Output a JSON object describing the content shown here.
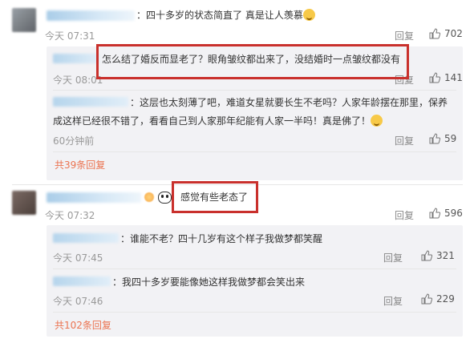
{
  "comments": [
    {
      "text": "：四十多岁的状态简直了 真是让人羡慕",
      "time": "今天 07:31",
      "reply_label": "回复",
      "likes": "702",
      "replies": [
        {
          "text": "怎么结了婚反而显老了？眼角皱纹都出来了，没结婚时一点皱纹都没有",
          "time": "今天 08:01",
          "reply_label": "回复",
          "likes": "141"
        },
        {
          "text_line1": "：这层也太刻薄了吧，难道女星就要长生不老吗？人家年龄摆在那里，保养",
          "text_line2": "成这样已经很不错了，看看自己到人家那年纪能有人家一半吗！真是佛了！",
          "time": "60分钟前",
          "reply_label": "回复",
          "likes": "59"
        }
      ],
      "more_replies": "共39条回复"
    },
    {
      "text": "感觉有些老态了",
      "time": "今天 07:32",
      "reply_label": "回复",
      "likes": "596",
      "replies": [
        {
          "text": "：谁能不老？四十几岁有这个样子我做梦都笑醒",
          "time": "今天 07:45",
          "reply_label": "回复",
          "likes": "321"
        },
        {
          "text": "：我四十多岁要能像她这样我做梦都会笑出来",
          "time": "今天 07:46",
          "reply_label": "回复",
          "likes": "229"
        }
      ],
      "more_replies": "共102条回复"
    }
  ],
  "icons": {
    "like": "thumbs-up-icon",
    "emoji": "smile-emoji-icon",
    "panda": "panda-emoji-icon"
  },
  "colors": {
    "highlight_box": "#c9302c",
    "link": "#eb7350",
    "sub_background": "#f2f2f5"
  }
}
